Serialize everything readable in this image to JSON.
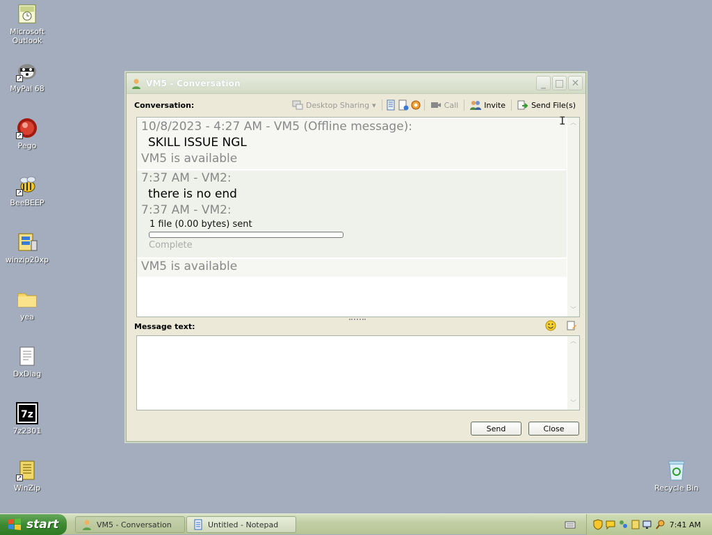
{
  "desktop": {
    "icons": [
      {
        "label": "Microsoft\nOutlook",
        "icon": "outlook-icon"
      },
      {
        "label": "MyPal 68",
        "icon": "mypal-icon"
      },
      {
        "label": "Pego",
        "icon": "pego-icon"
      },
      {
        "label": "BeeBEEP",
        "icon": "beebeep-icon"
      },
      {
        "label": "winzip20xp",
        "icon": "winzip-installer-icon"
      },
      {
        "label": "yea",
        "icon": "folder-icon"
      },
      {
        "label": "DxDiag",
        "icon": "dxdiag-icon"
      },
      {
        "label": "7z2301",
        "icon": "7zip-icon"
      },
      {
        "label": "WinZip",
        "icon": "winzip-icon"
      }
    ],
    "recycle_bin": {
      "label": "Recycle Bin",
      "icon": "recycle-bin-icon"
    }
  },
  "window": {
    "title": "VM5 - Conversation",
    "conversation_label": "Conversation:",
    "toolbar": {
      "desktop_sharing": "Desktop Sharing",
      "call": "Call",
      "invite": "Invite",
      "send_files": "Send File(s)"
    },
    "messages": {
      "m1_head": "10/8/2023 - 4:27 AM - VM5 (Offline message):",
      "m1_body": "SKILL ISSUE NGL",
      "status1": "VM5 is available",
      "m2_head": "7:37 AM - VM2:",
      "m2_body": "there is no end",
      "m3_head": "7:37 AM - VM2:",
      "file_line": "1 file (0.00 bytes) sent",
      "file_progress": 0,
      "complete": "Complete",
      "status2": "VM5 is available"
    },
    "message_text_label": "Message text:",
    "message_value": "",
    "send_label": "Send",
    "close_label": "Close"
  },
  "taskbar": {
    "start_label": "start",
    "tasks": [
      {
        "label": "VM5 - Conversation",
        "icon": "beebeep-icon"
      },
      {
        "label": "Untitled - Notepad",
        "icon": "notepad-icon"
      }
    ],
    "clock": "7:41 AM"
  }
}
